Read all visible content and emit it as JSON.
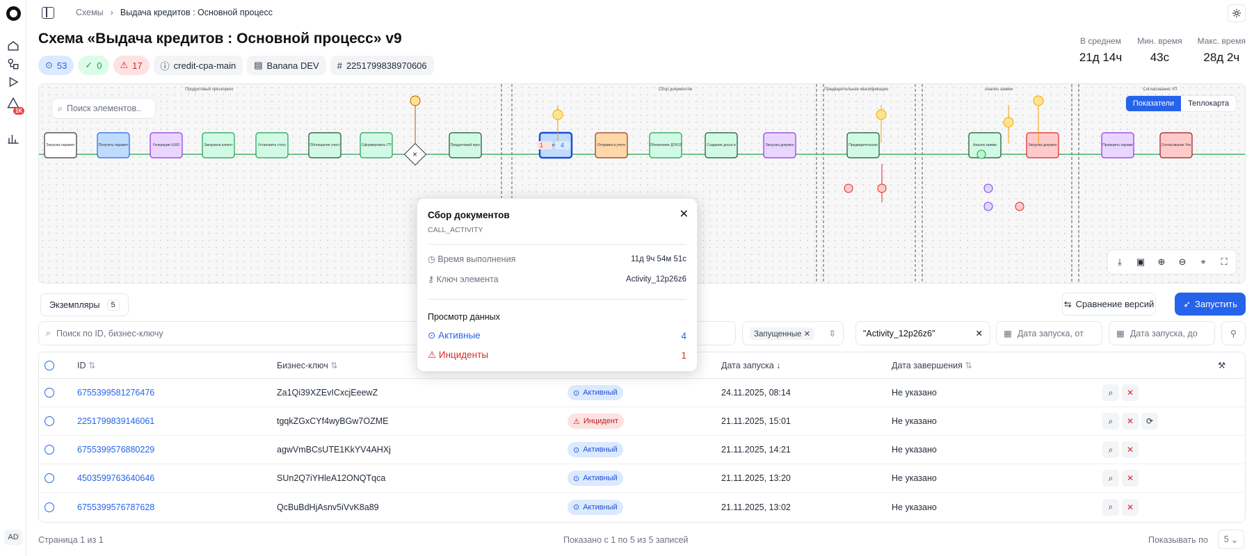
{
  "sidebar": {
    "badge": "1K",
    "avatar": "AD"
  },
  "breadcrumb": {
    "root": "Схемы",
    "current": "Выдача кредитов : Основной процесс"
  },
  "page": {
    "title": "Схема «Выдача кредитов : Основной процесс» v9"
  },
  "chips": {
    "active": "53",
    "done": "0",
    "incidents": "17",
    "project": "credit-cpa-main",
    "env": "Banana DEV",
    "id": "2251799838970606"
  },
  "stats": [
    {
      "label": "В среднем",
      "value": "21д 14ч"
    },
    {
      "label": "Мин. время",
      "value": "43с"
    },
    {
      "label": "Макс. время",
      "value": "28д 2ч"
    }
  ],
  "diagram": {
    "search_placeholder": "Поиск элементов..",
    "mode_on": "Показатели",
    "mode_off": "Теплокарта",
    "badge_incidents": "1",
    "badge_active": "4",
    "lanes": [
      "Продуктовый прескоринг",
      "Сбор документов",
      "Предварительная квалификация",
      "Анализ заявки",
      "Согласование УП"
    ],
    "tasks": [
      "Загрузка параметров вызова",
      "Получить параметры анализа транзакций по продавителям",
      "Генерация UUID",
      "Закорзина клиента",
      "Установить статус заявки",
      "Обогащение участников сделки",
      "Сформировать ГП по заявке",
      "Продуктовый прескоринг",
      "Сбор документов",
      "Отправка в учетной системе",
      "Обновление ДГКОЗ",
      "Создание досье в ЭА",
      "Загрузка документов в ЭА",
      "Предварительная квалификация",
      "Анализ заявки",
      "Загрузка документов в ЭА",
      "Проверить параметры продукта",
      "Согласование Уполномоченным лицом"
    ]
  },
  "popup": {
    "title": "Сбор документов",
    "type": "CALL_ACTIVITY",
    "exec_label": "Время выполнения",
    "exec_value": "11д 9ч 54м 51с",
    "key_label": "Ключ элемента",
    "key_value": "Activity_12p26z6",
    "data_head": "Просмотр данных",
    "active_label": "Активные",
    "active_count": "4",
    "inc_label": "Инциденты",
    "inc_count": "1"
  },
  "instances": {
    "tab_label": "Экземпляры",
    "count": "5"
  },
  "buttons": {
    "compare": "Сравнение версий",
    "run": "Запустить"
  },
  "filters": {
    "search_placeholder": "Поиск по ID, бизнес-ключу",
    "state": "Запущенные",
    "element": "\"Activity_12p26z6\"",
    "date_from": "Дата запуска, от",
    "date_to": "Дата запуска, до"
  },
  "table": {
    "headers": {
      "id": "ID",
      "key": "Бизнес-ключ",
      "start": "Дата запуска",
      "end": "Дата завершения"
    },
    "rows": [
      {
        "id": "6755399581276476",
        "key": "Za1Qi39XZEvICxcjEeewZ",
        "status": "Активный",
        "start": "24.11.2025, 08:14",
        "end": "Не указано"
      },
      {
        "id": "2251799839146061",
        "key": "tgqkZGxCYf4wyBGw7OZME",
        "status": "Инцидент",
        "start": "21.11.2025, 15:01",
        "end": "Не указано"
      },
      {
        "id": "6755399576880229",
        "key": "agwVmBCsUTE1KkYV4AHXj",
        "status": "Активный",
        "start": "21.11.2025, 14:21",
        "end": "Не указано"
      },
      {
        "id": "4503599763640646",
        "key": "SUn2Q7iYHleA12ONQTqca",
        "status": "Активный",
        "start": "21.11.2025, 13:20",
        "end": "Не указано"
      },
      {
        "id": "6755399576787628",
        "key": "QcBuBdHjAsnv5iVvK8a89",
        "status": "Активный",
        "start": "21.11.2025, 13:02",
        "end": "Не указано"
      }
    ]
  },
  "footer": {
    "pages": "Страница 1 из 1",
    "shown": "Показано с 1 по 5 из 5 записей",
    "per_page_label": "Показывать по",
    "per_page": "5"
  },
  "colors": {
    "accent": "#2563eb",
    "danger": "#dc2626",
    "success": "#16a34a"
  }
}
